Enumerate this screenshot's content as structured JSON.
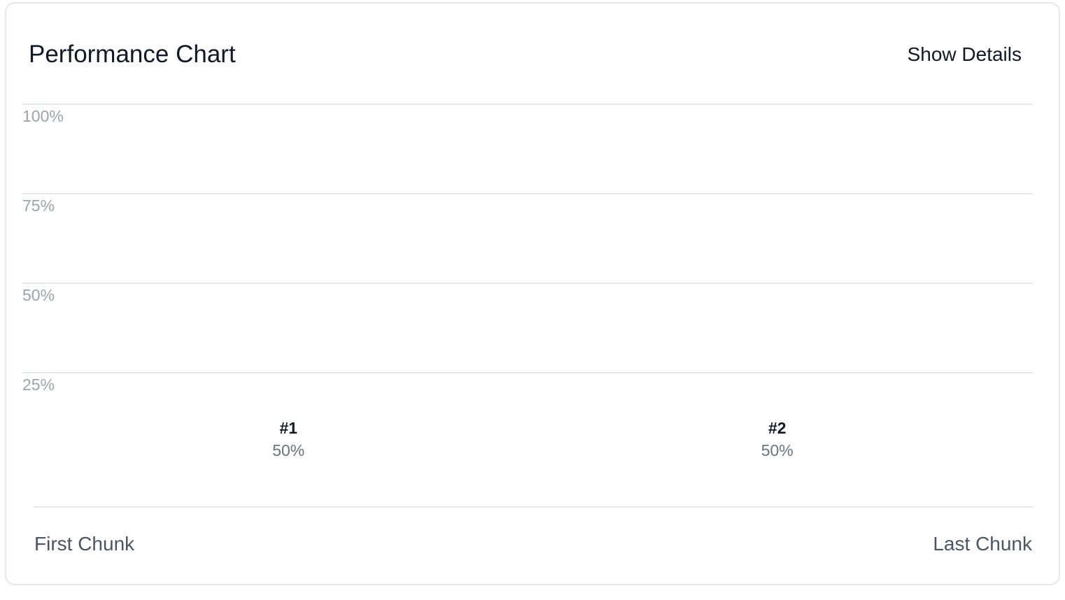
{
  "header": {
    "title": "Performance Chart",
    "details_button": "Show Details"
  },
  "chart_data": {
    "type": "bar",
    "title": "Performance Chart",
    "categories": [
      "#1",
      "#2"
    ],
    "values": [
      50,
      50
    ],
    "value_labels": [
      "50%",
      "50%"
    ],
    "ylim": [
      0,
      100
    ],
    "y_ticks": [
      100,
      75,
      50,
      25
    ],
    "y_tick_labels": [
      "100%",
      "75%",
      "50%",
      "25%"
    ],
    "x_start_label": "First Chunk",
    "x_end_label": "Last Chunk",
    "grid": true,
    "colors": {
      "grid": "#e5e7eb",
      "tick_label": "#9ca3af",
      "category_label": "#111827",
      "value_label": "#6b7280"
    }
  }
}
